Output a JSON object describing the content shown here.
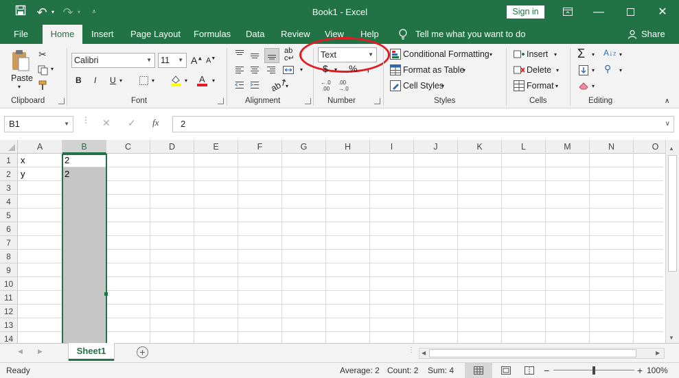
{
  "title": {
    "text": "Book1  -  Excel",
    "sign_in": "Sign in"
  },
  "tabs": [
    "File",
    "Home",
    "Insert",
    "Page Layout",
    "Formulas",
    "Data",
    "Review",
    "View",
    "Help"
  ],
  "tell_me": "Tell me what you want to do",
  "share": "Share",
  "ribbon": {
    "clipboard": {
      "label": "Clipboard",
      "paste": "Paste"
    },
    "font": {
      "label": "Font",
      "name": "Calibri",
      "size": "11",
      "bold": "B",
      "italic": "I",
      "underline": "U"
    },
    "alignment": {
      "label": "Alignment"
    },
    "number": {
      "label": "Number",
      "format": "Text",
      "currency": "$",
      "percent": "%",
      "inc_dec": ".0→.00",
      "dec_dec": ".00→.0"
    },
    "styles": {
      "label": "Styles",
      "conditional": "Conditional Formatting",
      "format_table": "Format as Table",
      "cell_styles": "Cell Styles"
    },
    "cells": {
      "label": "Cells",
      "insert": "Insert",
      "delete": "Delete",
      "format": "Format"
    },
    "editing": {
      "label": "Editing"
    }
  },
  "formula_bar": {
    "name_box": "B1",
    "fx": "fx",
    "value": "2"
  },
  "columns": [
    "A",
    "B",
    "C",
    "D",
    "E",
    "F",
    "G",
    "H",
    "I",
    "J",
    "K",
    "L",
    "M",
    "N",
    "O"
  ],
  "rows": [
    "1",
    "2",
    "3",
    "4",
    "5",
    "6",
    "7",
    "8",
    "9",
    "10",
    "11",
    "12",
    "13",
    "14"
  ],
  "cells": {
    "A1": "x",
    "B1": "2",
    "A2": "y",
    "B2": "2"
  },
  "sheet_tab": "Sheet1",
  "status": {
    "ready": "Ready",
    "average": "Average: 2",
    "count": "Count: 2",
    "sum": "Sum: 4",
    "zoom": "100%"
  },
  "colors": {
    "accent": "#217346",
    "annotation": "#e21b24",
    "selection": "#c6c6c6"
  }
}
